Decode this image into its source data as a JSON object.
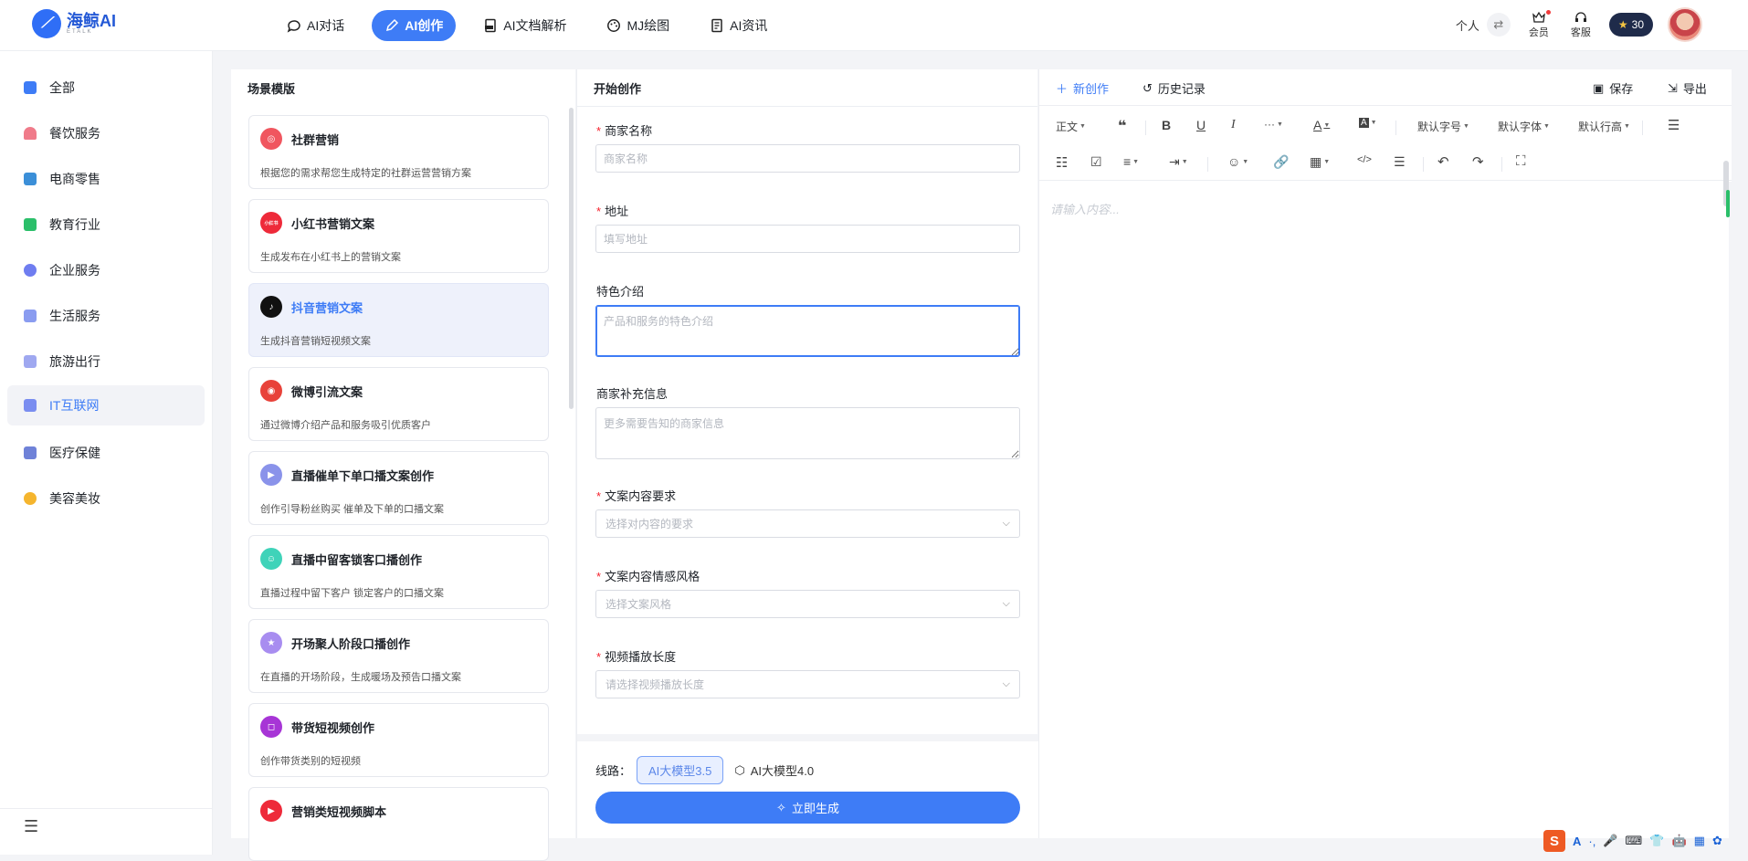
{
  "brand": {
    "name": "海鲸AI",
    "sub": "ETALK"
  },
  "nav": [
    {
      "label": "AI对话",
      "icon": "chat-bubble-icon"
    },
    {
      "label": "AI创作",
      "icon": "pencil-icon",
      "active": true
    },
    {
      "label": "AI文档解析",
      "icon": "pdf-icon"
    },
    {
      "label": "MJ绘图",
      "icon": "palette-icon"
    },
    {
      "label": "AI资讯",
      "icon": "news-icon"
    }
  ],
  "header": {
    "personal": "个人",
    "member": "会员",
    "service": "客服",
    "credits": "30"
  },
  "sidebar": [
    {
      "label": "全部",
      "color": "#3e7cf6"
    },
    {
      "label": "餐饮服务",
      "color": "#f07b8a"
    },
    {
      "label": "电商零售",
      "color": "#3b8fd8"
    },
    {
      "label": "教育行业",
      "color": "#2bbf6a"
    },
    {
      "label": "企业服务",
      "color": "#6f7df0"
    },
    {
      "label": "生活服务",
      "color": "#8a9cf0"
    },
    {
      "label": "旅游出行",
      "color": "#9fa8f0"
    },
    {
      "label": "IT互联网",
      "color": "#7a8df0",
      "active": true
    },
    {
      "label": "医疗保健",
      "color": "#6f82d8"
    },
    {
      "label": "美容美妆",
      "color": "#f5b52e"
    }
  ],
  "scene": {
    "title": "场景模版",
    "cards": [
      {
        "title": "社群营销",
        "desc": "根据您的需求帮您生成特定的社群运营营销方案",
        "color": "#f0565f",
        "glyph": "◎"
      },
      {
        "title": "小红书营销文案",
        "desc": "生成发布在小红书上的营销文案",
        "color": "#ee2a3a",
        "glyph": "小红书"
      },
      {
        "title": "抖音营销文案",
        "desc": "生成抖音营销短视频文案",
        "color": "#111111",
        "glyph": "♪",
        "active": true
      },
      {
        "title": "微博引流文案",
        "desc": "通过微博介绍产品和服务吸引优质客户",
        "color": "#e8423a",
        "glyph": "◉"
      },
      {
        "title": "直播催单下单口播文案创作",
        "desc": "创作引导粉丝购买 催单及下单的口播文案",
        "color": "#8a93ea",
        "glyph": "▶"
      },
      {
        "title": "直播中留客锁客口播创作",
        "desc": "直播过程中留下客户 锁定客户的口播文案",
        "color": "#3fd3b9",
        "glyph": "☺"
      },
      {
        "title": "开场聚人阶段口播创作",
        "desc": "在直播的开场阶段，生成暖场及预告口播文案",
        "color": "#a88df0",
        "glyph": "★"
      },
      {
        "title": "带货短视频创作",
        "desc": "创作带货类别的短视频",
        "color": "#a735d6",
        "glyph": "◻"
      },
      {
        "title": "营销类短视频脚本",
        "desc": "",
        "color": "#ee2a3a",
        "glyph": "▶"
      }
    ]
  },
  "form": {
    "title": "开始创作",
    "merchant_label": "商家名称",
    "merchant_ph": "商家名称",
    "address_label": "地址",
    "address_ph": "填写地址",
    "feature_label": "特色介绍",
    "feature_ph": "产品和服务的特色介绍",
    "extra_label": "商家补充信息",
    "extra_ph": "更多需要告知的商家信息",
    "req_label": "文案内容要求",
    "req_ph": "选择对内容的要求",
    "style_label": "文案内容情感风格",
    "style_ph": "选择文案风格",
    "len_label": "视频播放长度",
    "len_ph": "请选择视频播放长度",
    "route_label": "线路：",
    "model_a": "AI大模型3.5",
    "model_b": "AI大模型4.0",
    "generate": "立即生成"
  },
  "editor": {
    "new": "新创作",
    "history": "历史记录",
    "save": "保存",
    "export": "导出",
    "para": "正文",
    "fontsize": "默认字号",
    "fontfamily": "默认字体",
    "lineheight": "默认行高",
    "placeholder": "请输入内容..."
  },
  "ime": {
    "s": "S",
    "items": [
      "A",
      "·,",
      "🎤",
      "⌨",
      "👕",
      "🤖",
      "▦",
      "✿"
    ]
  }
}
